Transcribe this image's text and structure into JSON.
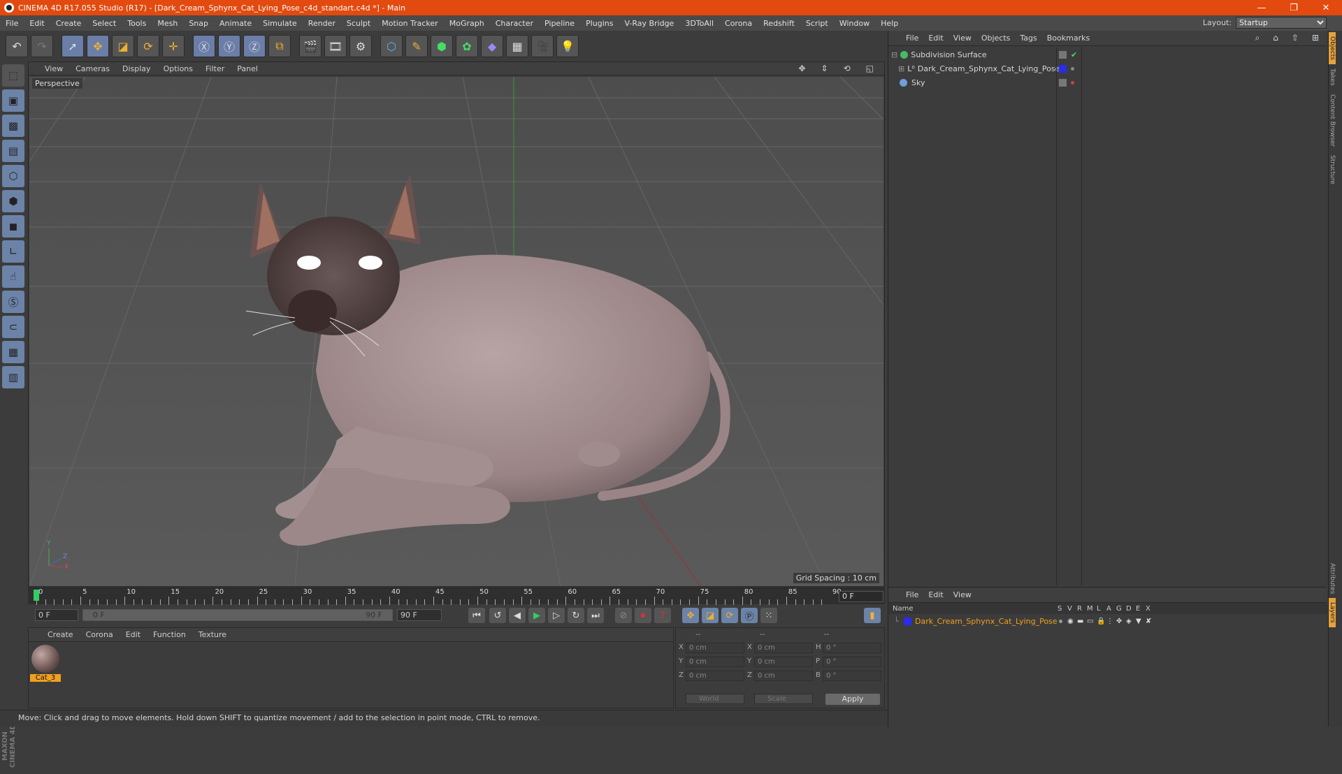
{
  "window": {
    "title": "CINEMA 4D R17.055 Studio (R17) - [Dark_Cream_Sphynx_Cat_Lying_Pose_c4d_standart.c4d *] - Main",
    "minimize": "—",
    "restore": "❐",
    "close": "✕"
  },
  "menubar": {
    "items": [
      "File",
      "Edit",
      "Create",
      "Select",
      "Tools",
      "Mesh",
      "Snap",
      "Animate",
      "Simulate",
      "Render",
      "Sculpt",
      "Motion Tracker",
      "MoGraph",
      "Character",
      "Pipeline",
      "Plugins",
      "V-Ray Bridge",
      "3DToAll",
      "Corona",
      "Redshift",
      "Script",
      "Window",
      "Help"
    ],
    "layout_label": "Layout:",
    "layout_value": "Startup"
  },
  "viewport": {
    "menu": [
      "View",
      "Cameras",
      "Display",
      "Options",
      "Filter",
      "Panel"
    ],
    "camera_label": "Perspective",
    "grid_spacing": "Grid Spacing : 10 cm",
    "axis_y": "Y",
    "axis_z": "Z",
    "axis_x": "X"
  },
  "timeline": {
    "ticks": [
      "0",
      "5",
      "10",
      "15",
      "20",
      "25",
      "30",
      "35",
      "40",
      "45",
      "50",
      "55",
      "60",
      "65",
      "70",
      "75",
      "80",
      "85",
      "90"
    ],
    "current_frame": "0 F"
  },
  "transport": {
    "start_frame": "0 F",
    "range_start": "0 F",
    "range_end": "90 F",
    "end_frame": "90 F"
  },
  "material_manager": {
    "menu": [
      "Create",
      "Corona",
      "Edit",
      "Function",
      "Texture"
    ],
    "materials": [
      {
        "name": "Cat_3"
      }
    ]
  },
  "coordinates": {
    "header": [
      "--",
      "--",
      "--"
    ],
    "rows": [
      {
        "a": "X",
        "v1": "0 cm",
        "b": "X",
        "v2": "0 cm",
        "c": "H",
        "v3": "0 °"
      },
      {
        "a": "Y",
        "v1": "0 cm",
        "b": "Y",
        "v2": "0 cm",
        "c": "P",
        "v3": "0 °"
      },
      {
        "a": "Z",
        "v1": "0 cm",
        "b": "Z",
        "v2": "0 cm",
        "c": "B",
        "v3": "0 °"
      }
    ],
    "mode": "World",
    "transform": "Scale",
    "apply": "Apply"
  },
  "status": "Move: Click and drag to move elements. Hold down SHIFT to quantize movement / add to the selection in point mode, CTRL to remove.",
  "object_manager": {
    "menu": [
      "File",
      "Edit",
      "View",
      "Objects",
      "Tags",
      "Bookmarks"
    ],
    "objects": [
      {
        "name": "Subdivision Surface",
        "color": "#44bb66"
      },
      {
        "name": "Dark_Cream_Sphynx_Cat_Lying_Pose",
        "color": "#2a2af0"
      },
      {
        "name": "Sky",
        "color": "#6fa0d8"
      }
    ]
  },
  "side_tabs": [
    "Objects",
    "Takes",
    "Content Browser",
    "Structure",
    "Attributes",
    "Layers"
  ],
  "layer_manager": {
    "menu": [
      "File",
      "Edit",
      "View"
    ],
    "columns": [
      "Name",
      "S",
      "V",
      "R",
      "M",
      "L",
      "A",
      "G",
      "D",
      "E",
      "X"
    ],
    "layers": [
      {
        "name": "Dark_Cream_Sphynx_Cat_Lying_Pose",
        "color": "#2a2af0"
      }
    ]
  },
  "colors": {
    "accent": "#e24a0f",
    "selection": "#f0a020",
    "tool_blue": "#6c83a8"
  }
}
